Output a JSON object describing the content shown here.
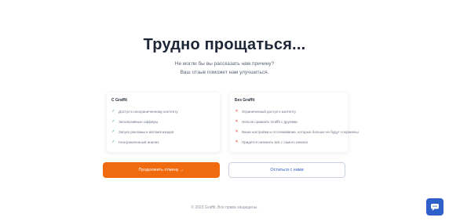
{
  "page": {
    "title": "Трудно прощаться...",
    "subtitle_line1": "Не могли бы вы рассказать нам причину?",
    "subtitle_line2": "Ваш отзыв поможет нам улучшиться."
  },
  "benefits": {
    "heading": "С Graffit",
    "items": [
      "Доступ к неограниченному контенту",
      "Эксклюзивные офферы",
      "Запуск рекламы и автоматизация",
      "Неограниченный анализ"
    ]
  },
  "losses": {
    "heading": "Без Graffit",
    "items": [
      "Ограниченный доступ к контенту",
      "Нельзя сравнить Graffit с другими",
      "Ваши настройки и отслеживание, которые больше не будут сохранены",
      "Придется начинать всё с самого начала"
    ]
  },
  "actions": {
    "cancel_label": "Продолжить отмену →",
    "stay_label": "Остаться с нами"
  },
  "footer": {
    "text": "© 2023 Graffit. Все права защищены."
  },
  "colors": {
    "accent": "#f06a10",
    "secondary": "#2f5fc8",
    "positive": "#22a45d",
    "negative": "#e24a3b"
  },
  "icons": {
    "positive": "check-icon",
    "negative": "cross-icon",
    "chat": "chat-icon"
  }
}
